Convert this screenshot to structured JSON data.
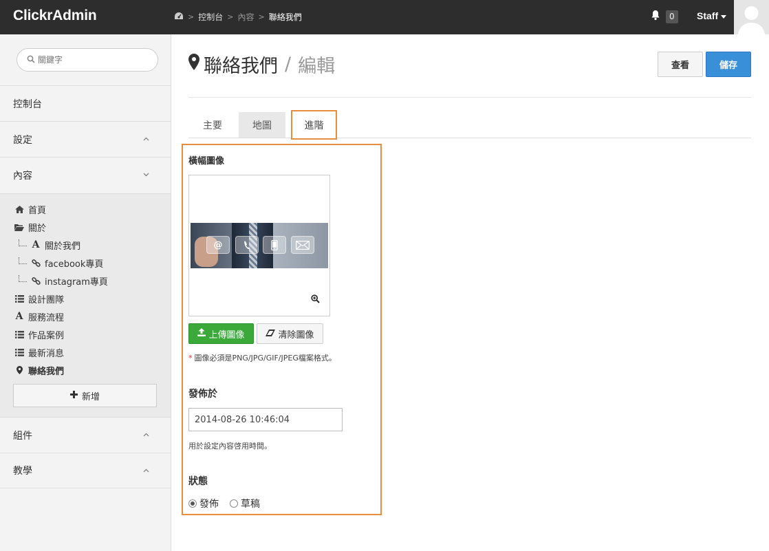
{
  "app": {
    "brand": "ClickrAdmin"
  },
  "breadcrumb": {
    "items": [
      "控制台",
      "內容",
      "聯絡我們"
    ]
  },
  "header": {
    "notification_count": "0",
    "user_label": "Staff"
  },
  "sidebar": {
    "search_placeholder": "關鍵字",
    "sections": {
      "dashboard": "控制台",
      "settings": "設定",
      "content": "內容",
      "components": "組件",
      "tutorial": "教學"
    },
    "content_items": [
      {
        "label": "首頁",
        "icon": "home-icon"
      },
      {
        "label": "關於",
        "icon": "folder-open-icon"
      },
      {
        "label": "關於我們",
        "icon": "text-icon"
      },
      {
        "label": "facebook專頁",
        "icon": "link-icon"
      },
      {
        "label": "instagram專頁",
        "icon": "link-icon"
      },
      {
        "label": "設計團隊",
        "icon": "list-icon"
      },
      {
        "label": "服務流程",
        "icon": "text-icon"
      },
      {
        "label": "作品案例",
        "icon": "list-icon"
      },
      {
        "label": "最新消息",
        "icon": "list-icon"
      },
      {
        "label": "聯絡我們",
        "icon": "map-marker-icon"
      }
    ],
    "add_label": "新增"
  },
  "page": {
    "title": "聯絡我們",
    "subtitle": "編輯",
    "view_label": "查看",
    "save_label": "儲存",
    "tabs": [
      "主要",
      "地圖",
      "進階"
    ],
    "active_tab": "進階"
  },
  "form": {
    "banner_label": "橫幅圖像",
    "banner_icons": [
      "@",
      "phone-icon",
      "mobile-icon",
      "envelope-icon"
    ],
    "upload_label": "上傳圖像",
    "clear_label": "清除圖像",
    "image_note": "圖像必須是PNG/JPG/GIF/JPEG檔案格式。",
    "publish_label": "發佈於",
    "publish_value": "2014-08-26 10:46:04",
    "publish_help": "用於設定內容啓用時間。",
    "status_label": "狀態",
    "status_options": [
      "發佈",
      "草稿"
    ],
    "status_selected": "發佈"
  },
  "colors": {
    "accent_blue": "#3a8fd9",
    "upload_green": "#3aa93a",
    "highlight_orange": "#e88c3e",
    "topbar": "#2d2d2d"
  }
}
